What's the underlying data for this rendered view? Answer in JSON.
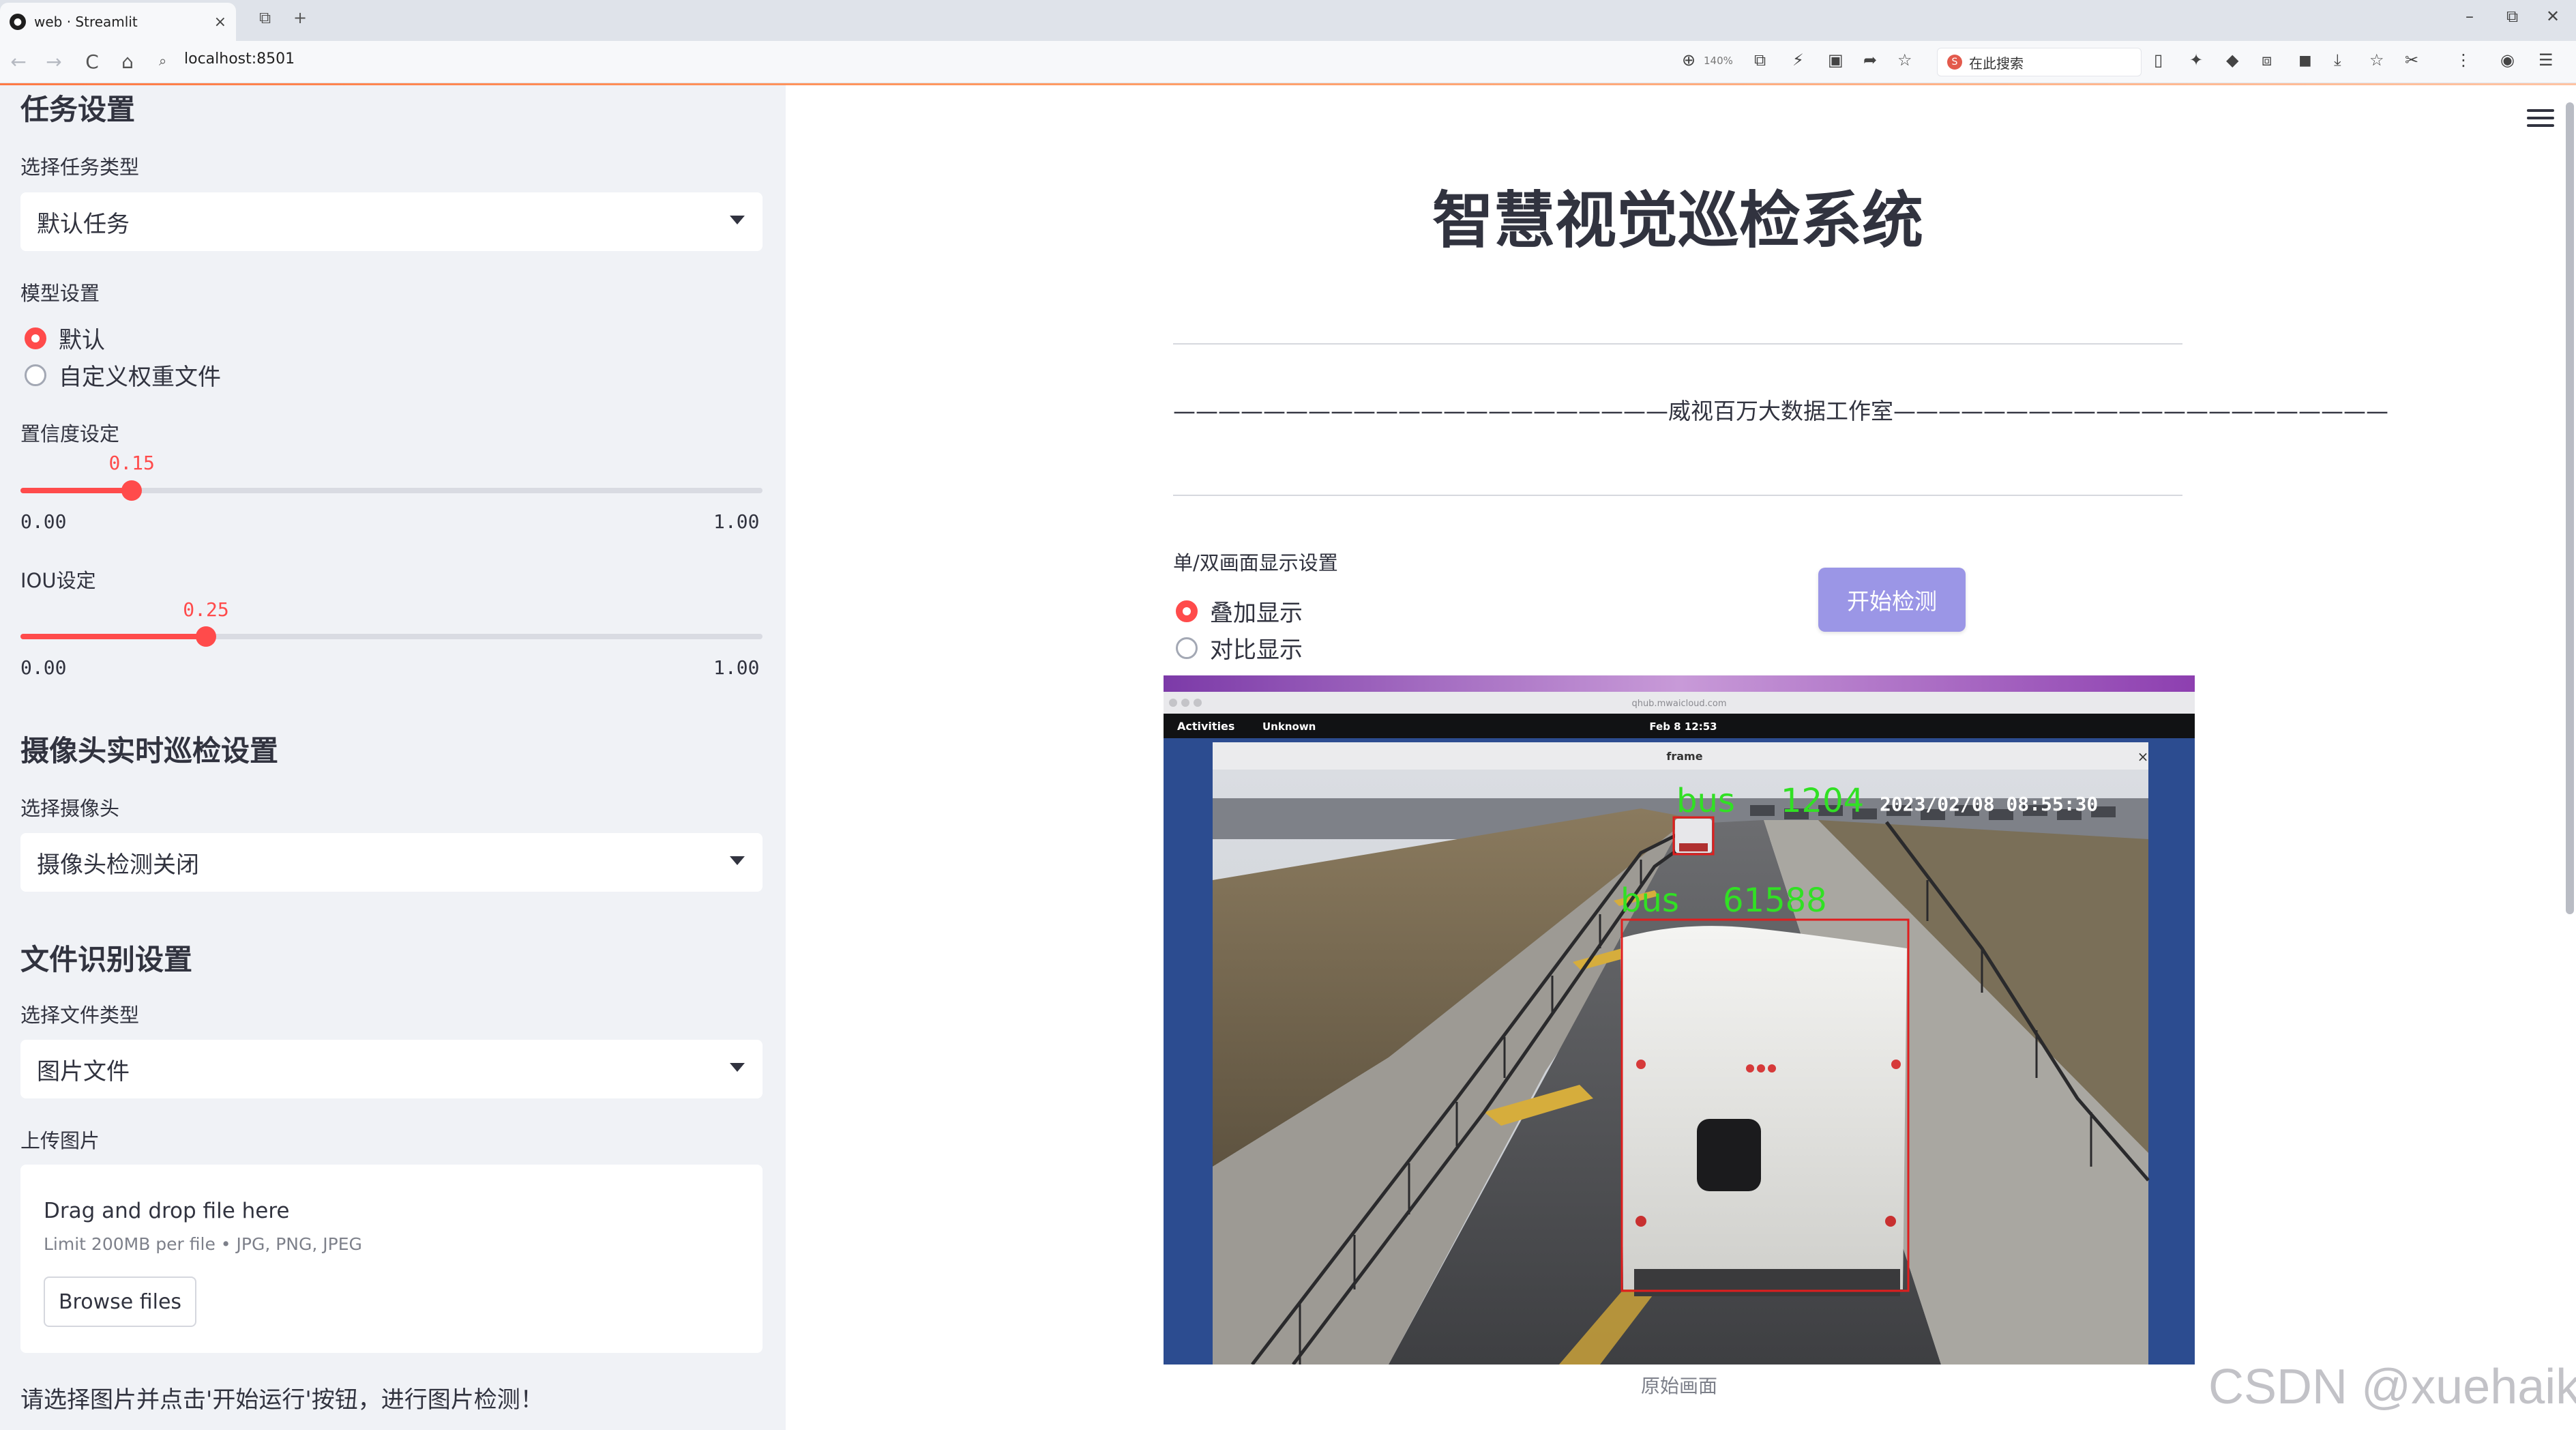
{
  "browser": {
    "tab_title": "web · Streamlit",
    "tab_close": "×",
    "new_tab": "+",
    "tab_list": "⧉",
    "url": "localhost:8501",
    "zoom": "140%",
    "search_engine_badge": "S",
    "search_placeholder": "在此搜索",
    "win_minimize": "–",
    "win_restore": "⧉",
    "win_close": "✕",
    "back": "←",
    "forward": "→",
    "reload": "C",
    "home": "⌂",
    "menu": "⋮"
  },
  "sidebar": {
    "task_section_title": "任务设置",
    "task_type_label": "选择任务类型",
    "task_type_value": "默认任务",
    "model_label": "模型设置",
    "model_options": [
      "默认",
      "自定义权重文件"
    ],
    "model_selected": 0,
    "conf_label": "置信度设定",
    "conf_value": "0.15",
    "conf_fraction": 0.15,
    "conf_min": "0.00",
    "conf_max": "1.00",
    "iou_label": "IOU设定",
    "iou_value": "0.25",
    "iou_fraction": 0.25,
    "iou_min": "0.00",
    "iou_max": "1.00",
    "camera_section_title": "摄像头实时巡检设置",
    "camera_label": "选择摄像头",
    "camera_value": "摄像头检测关闭",
    "file_section_title": "文件识别设置",
    "file_type_label": "选择文件类型",
    "file_type_value": "图片文件",
    "upload_label": "上传图片",
    "upload_title": "Drag and drop file here",
    "upload_limit": "Limit 200MB per file • JPG, PNG, JPEG",
    "browse_button": "Browse files",
    "note": "请选择图片并点击'开始运行'按钮，进行图片检测！"
  },
  "main": {
    "title": "智慧视觉巡检系统",
    "subtitle": "——————————————————————威视百万大数据工作室——————————————————————",
    "display_label": "单/双画面显示设置",
    "display_options": [
      "叠加显示",
      "对比显示"
    ],
    "display_selected": 0,
    "start_button": "开始检测",
    "caption": "原始画面"
  },
  "frame_image": {
    "window_url": "qhub.mwaicloud.com",
    "activities": "Activities",
    "unknown_app": "Unknown",
    "clock": "Feb 8  12:53",
    "window_title": "frame",
    "window_close": "×",
    "timestamp": "2023/02/08  08:55:30",
    "detections": [
      {
        "label": "bus",
        "id": "1204"
      },
      {
        "label": "bus",
        "id": "61588"
      }
    ]
  },
  "watermark": "CSDN @xuehaikj",
  "colors": {
    "accent": "#ff4b4b",
    "button": "#9b96e6",
    "sidebar_bg": "#f0f2f6",
    "detect_label": "#31e024",
    "detect_box": "#e01e1e"
  }
}
